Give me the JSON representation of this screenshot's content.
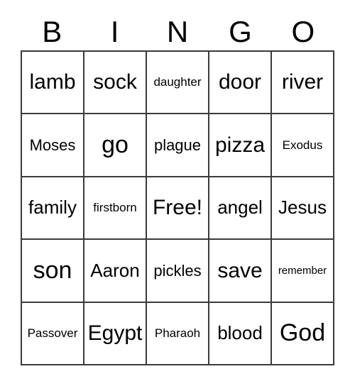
{
  "card": {
    "header": {
      "letters": [
        "B",
        "I",
        "N",
        "G",
        "O"
      ]
    },
    "grid": {
      "rows": 5,
      "columns": 5,
      "border_color": "#3a3a3a",
      "background_color": "#ffffff",
      "text_color": "#000000",
      "free_space": "Free!",
      "cells": [
        [
          {
            "label": "lamb",
            "size": "lg"
          },
          {
            "label": "sock",
            "size": "lg"
          },
          {
            "label": "daughter",
            "size": "xs"
          },
          {
            "label": "door",
            "size": "lg"
          },
          {
            "label": "river",
            "size": "lg"
          }
        ],
        [
          {
            "label": "Moses",
            "size": "sm"
          },
          {
            "label": "go",
            "size": "xl"
          },
          {
            "label": "plague",
            "size": "sm"
          },
          {
            "label": "pizza",
            "size": "lg"
          },
          {
            "label": "Exodus",
            "size": "xs"
          }
        ],
        [
          {
            "label": "family",
            "size": "md"
          },
          {
            "label": "firstborn",
            "size": "xs"
          },
          {
            "label": "Free!",
            "size": "lg"
          },
          {
            "label": "angel",
            "size": "md"
          },
          {
            "label": "Jesus",
            "size": "md"
          }
        ],
        [
          {
            "label": "son",
            "size": "xl"
          },
          {
            "label": "Aaron",
            "size": "md"
          },
          {
            "label": "pickles",
            "size": "sm"
          },
          {
            "label": "save",
            "size": "lg"
          },
          {
            "label": "remember",
            "size": "xxs"
          }
        ],
        [
          {
            "label": "Passover",
            "size": "xs"
          },
          {
            "label": "Egypt",
            "size": "lg"
          },
          {
            "label": "Pharaoh",
            "size": "xs"
          },
          {
            "label": "blood",
            "size": "md"
          },
          {
            "label": "God",
            "size": "xl"
          }
        ]
      ]
    }
  }
}
